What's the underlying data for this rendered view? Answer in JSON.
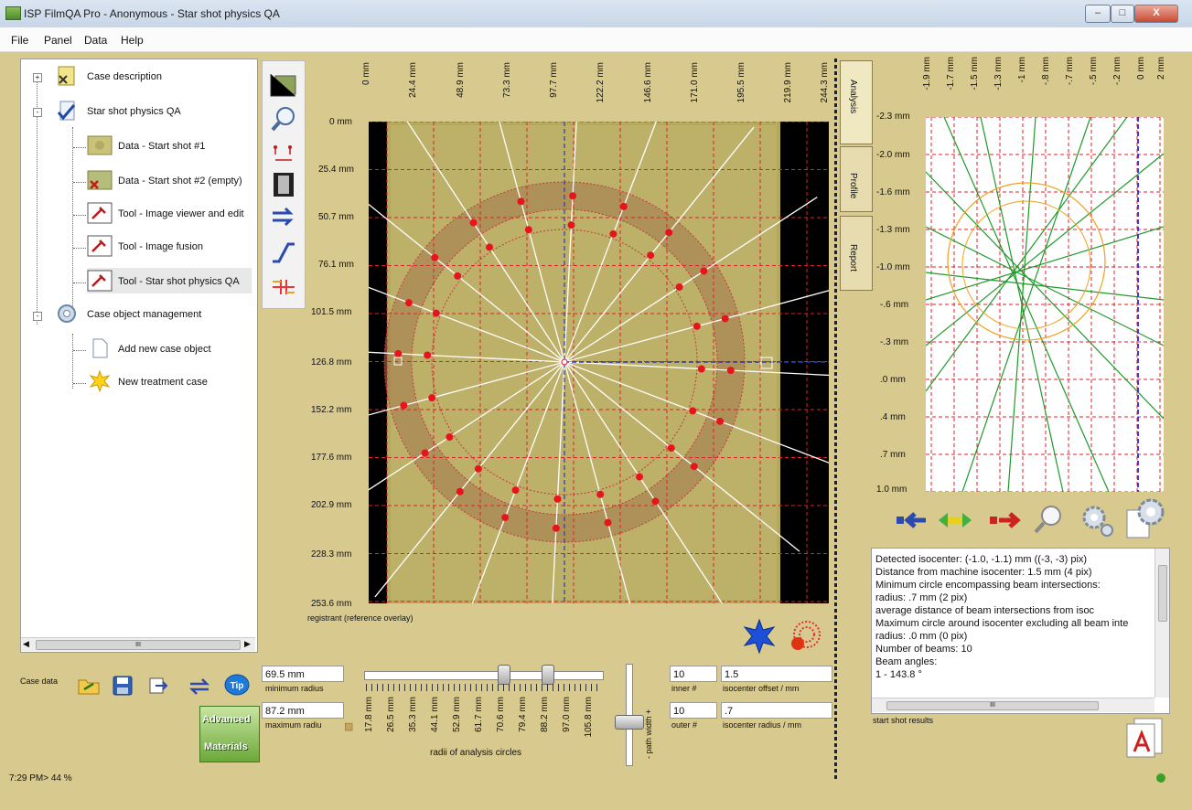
{
  "window": {
    "title": "ISP FilmQA Pro - Anonymous - Star shot physics QA",
    "min": "–",
    "max": "□",
    "close": "X"
  },
  "menu": [
    "File",
    "Panel",
    "Data",
    "Help"
  ],
  "tree": {
    "items": [
      {
        "label": "Case description",
        "icon": "folder-case-icon"
      },
      {
        "label": "Star shot physics QA",
        "icon": "checked-document-icon"
      },
      {
        "label": "Data - Start shot #1",
        "icon": "film-image-icon"
      },
      {
        "label": "Data - Start shot #2 (empty)",
        "icon": "film-image-empty-icon"
      },
      {
        "label": "Tool - Image viewer and edit",
        "icon": "tool-icon"
      },
      {
        "label": "Tool - Image fusion",
        "icon": "tool-icon"
      },
      {
        "label": "Tool - Star shot physics QA",
        "icon": "tool-icon"
      },
      {
        "label": "Case object management",
        "icon": "gears-icon"
      },
      {
        "label": "Add new case object",
        "icon": "new-document-icon"
      },
      {
        "label": "New treatment case",
        "icon": "star-burst-icon"
      }
    ]
  },
  "bottom_left": {
    "case_data_label": "Case data",
    "status": "7:29 PM> 44 %",
    "logo_line1": "Advanced",
    "logo_line2": "Materials",
    "scroll_mid": "III"
  },
  "image_axes": {
    "x_ticks": [
      "0 mm",
      "24.4 mm",
      "48.9 mm",
      "73.3 mm",
      "97.7 mm",
      "122.2 mm",
      "146.6 mm",
      "171.0 mm",
      "195.5 mm",
      "219.9 mm",
      "244.3 mm"
    ],
    "y_ticks": [
      "0 mm",
      "25.4 mm",
      "50.7 mm",
      "76.1 mm",
      "101.5 mm",
      "126.8 mm",
      "152.2 mm",
      "177.6 mm",
      "202.9 mm",
      "228.3 mm",
      "253.6 mm"
    ]
  },
  "image": {
    "caption": "registrant (reference overlay)"
  },
  "controls": {
    "min_radius": "69.5 mm",
    "min_radius_label": "minimum radius",
    "max_radius": "87.2 mm",
    "max_radius_label": "maximum radiu",
    "radii_ticks": [
      "17.8 mm",
      "26.5 mm",
      "35.3 mm",
      "44.1 mm",
      "52.9 mm",
      "61.7 mm",
      "70.6 mm",
      "79.4 mm",
      "88.2 mm",
      "97.0 mm",
      "105.8 mm"
    ],
    "radii_label": "radii of analysis circles",
    "path_width_label": "- path width +",
    "inner_n": "10",
    "inner_label": "inner #",
    "outer_n": "10",
    "outer_label": "outer #",
    "iso_offset": "1.5",
    "iso_offset_label": "isocenter offset / mm",
    "iso_radius": ".7",
    "iso_radius_label": "isocenter radius / mm"
  },
  "side_tabs": [
    "Analysis",
    "Profile",
    "Report"
  ],
  "right_plot": {
    "x_ticks": [
      "-1.9 mm",
      "-1.7 mm",
      "-1.5 mm",
      "-1.3 mm",
      "-1 mm",
      "-.8 mm",
      "-.7 mm",
      "-.5 mm",
      "-.2 mm",
      "0 mm",
      "2 mm"
    ],
    "y_ticks": [
      "-2.3 mm",
      "-2.0 mm",
      "-1.6 mm",
      "-1.3 mm",
      "-1.0 mm",
      "-.6 mm",
      "-.3 mm",
      ".0 mm",
      ".4 mm",
      ".7 mm",
      "1.0 mm"
    ]
  },
  "results": {
    "lines": [
      "Detected isocenter: (-1.0, -1.1) mm  ((-3, -3) pix)",
      "Distance from machine isocenter: 1.5 mm  (4 pix)",
      "Minimum circle encompassing beam intersections:",
      "              radius: .7 mm  (2 pix)",
      "              average distance of beam intersections from isoc",
      "Maximum circle around isocenter excluding all beam inte",
      "              radius: .0 mm  (0 pix)",
      "Number of beams: 10",
      "Beam angles:",
      "1 - 143.8 °"
    ],
    "caption": "start shot results",
    "scroll_mid": "III"
  },
  "colors": {
    "panel_bg": "#d8c98f",
    "grid": "#e0202a",
    "beam": "#ffffff",
    "marker": "#e8141c",
    "iso_line": "#2b38c9",
    "green_line": "#1f9a2a",
    "orange_circle": "#f0a020"
  }
}
